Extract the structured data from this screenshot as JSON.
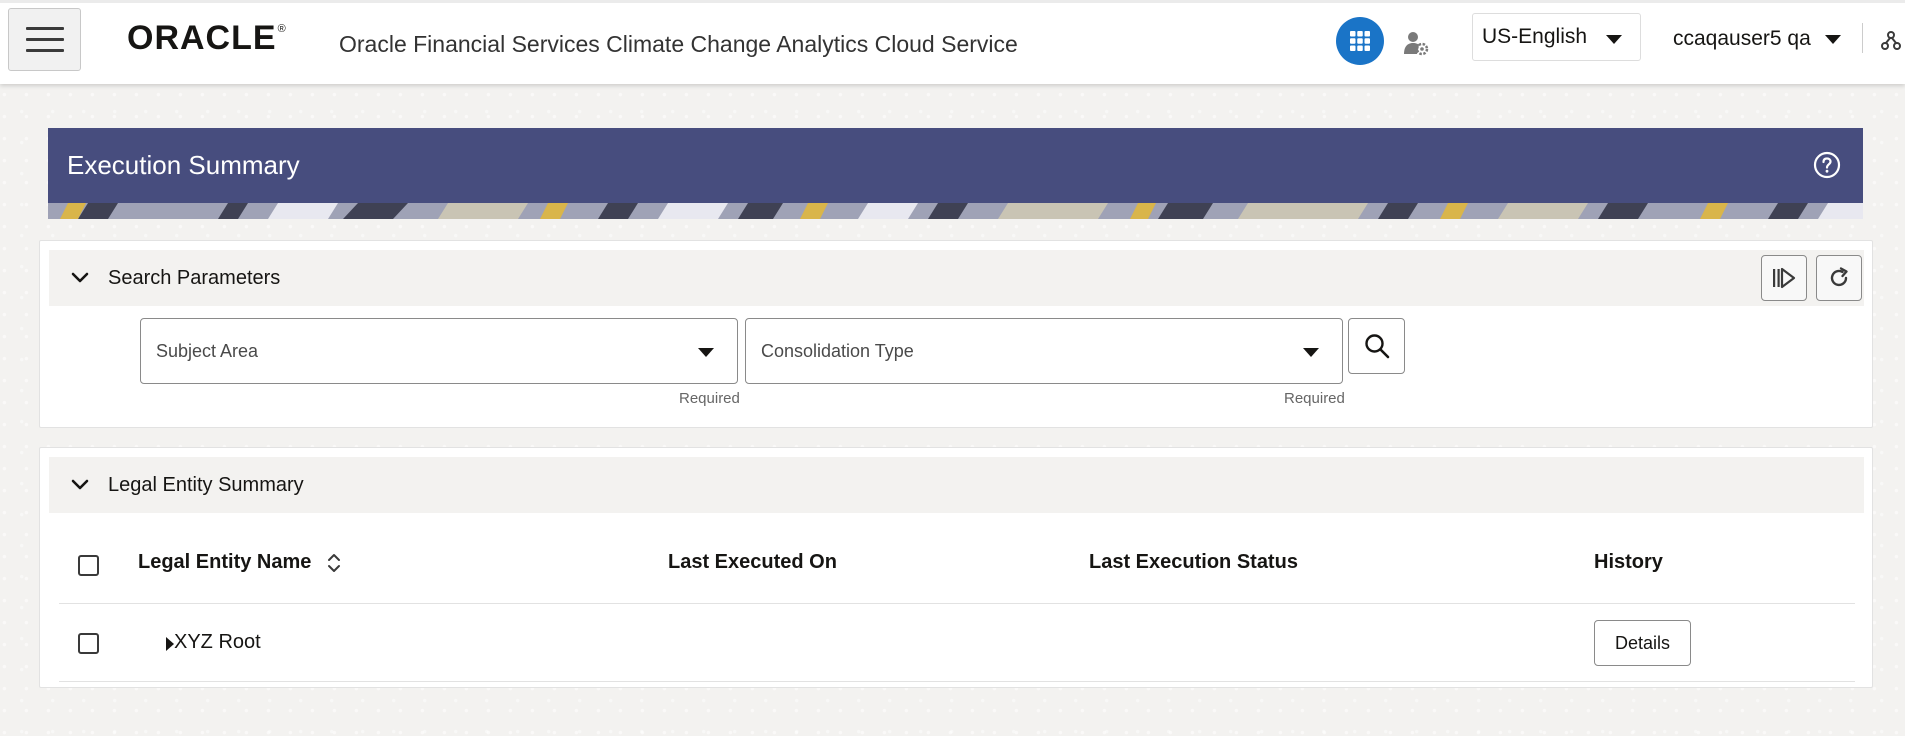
{
  "header": {
    "logo_text": "ORACLE",
    "logo_reg": "®",
    "app_title": "Oracle Financial Services Climate Change Analytics Cloud Service",
    "language": "US-English",
    "user": "ccaqauser5 qa"
  },
  "banner": {
    "title": "Execution Summary"
  },
  "search_panel": {
    "label": "Search Parameters",
    "fields": [
      {
        "label": "Subject Area",
        "help": "Required"
      },
      {
        "label": "Consolidation Type",
        "help": "Required"
      }
    ]
  },
  "legal_panel": {
    "label": "Legal Entity Summary",
    "columns": [
      "Legal Entity Name",
      "Last Executed On",
      "Last Execution Status",
      "History"
    ],
    "rows": [
      {
        "name": "XYZ Root",
        "last_executed_on": "",
        "last_status": "",
        "history_button": "Details"
      }
    ]
  },
  "colors": {
    "banner_bg": "#474d7e",
    "accent_blue": "#1a74c7",
    "page_bg": "#f3f2f0"
  },
  "icons": [
    "hamburger-icon",
    "apps-grid-icon",
    "user-gear-icon",
    "share-icon",
    "help-icon",
    "chevron-down-icon",
    "execute-icon",
    "refresh-icon",
    "search-icon",
    "sort-icon",
    "expand-caret-icon"
  ]
}
